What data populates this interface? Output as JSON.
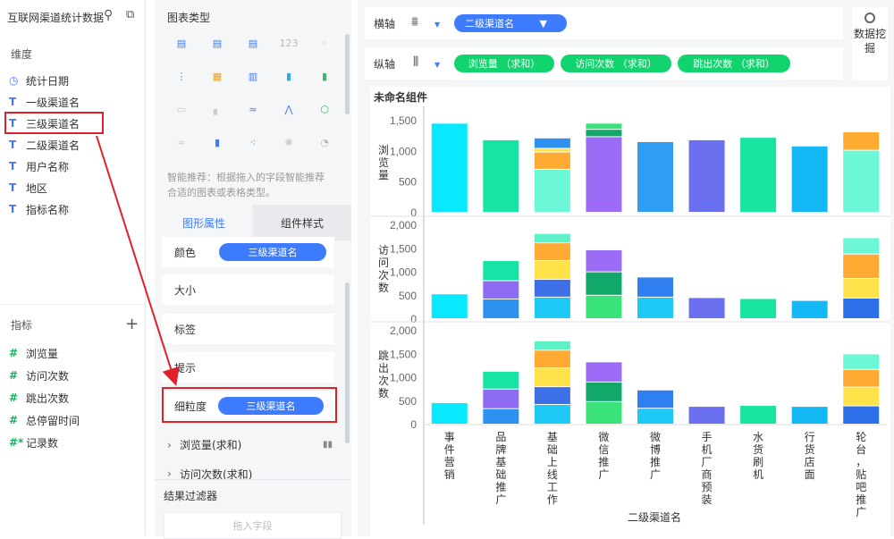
{
  "left": {
    "dataset_title": "互联网渠道统计数据",
    "search_icon": "search-icon",
    "switch_icon": "switch-icon",
    "dimension_title": "维度",
    "dimensions": [
      {
        "icon": "clock",
        "label": "统计日期"
      },
      {
        "icon": "T",
        "label": "一级渠道名"
      },
      {
        "icon": "T",
        "label": "三级渠道名"
      },
      {
        "icon": "T",
        "label": "二级渠道名"
      },
      {
        "icon": "T",
        "label": "用户名称"
      },
      {
        "icon": "T",
        "label": "地区"
      },
      {
        "icon": "T",
        "label": "指标名称"
      }
    ],
    "metric_title": "指标",
    "add_symbol": "+",
    "metrics": [
      {
        "icon": "#",
        "label": "浏览量"
      },
      {
        "icon": "#",
        "label": "访问次数"
      },
      {
        "icon": "#",
        "label": "跳出次数"
      },
      {
        "icon": "#",
        "label": "总停留时间"
      },
      {
        "icon": "#*",
        "label": "记录数"
      }
    ]
  },
  "middle": {
    "chart_type_title": "图表类型",
    "smart_tip": "智能推荐：根据拖入的字段智能推荐合适的图表或表格类型。",
    "tabs": {
      "graph": "图形属性",
      "style": "组件样式"
    },
    "props": {
      "color_label": "颜色",
      "color_field": "三级渠道名",
      "size_label": "大小",
      "tag_label": "标签",
      "tip_label": "提示",
      "granularity_label": "细粒度",
      "granularity_field": "三级渠道名"
    },
    "agg_rows": [
      "浏览量(求和)",
      "访问次数(求和)"
    ],
    "filter_title": "结果过滤器",
    "drop_placeholder": "拖入字段"
  },
  "axes": {
    "x_label": "横轴",
    "x_field": "二级渠道名",
    "y_label": "纵轴",
    "y_fields": [
      "浏览量 （求和）",
      "访问次数 （求和）",
      "跳出次数 （求和）"
    ],
    "data_mining": "数据挖掘"
  },
  "chart_data": {
    "type": "bar",
    "stacked": true,
    "title": "未命名组件",
    "xlabel": "二级渠道名",
    "categories": [
      "事件营销",
      "品牌基础推广",
      "基础上线工作",
      "微信推广",
      "微博推广",
      "手机厂商预装",
      "水货刷机",
      "行货店面",
      "轮台，贴吧推广"
    ],
    "panels": [
      {
        "ylabel": "浏览量",
        "ylim": [
          0,
          1600
        ],
        "yticks": [
          "1,500",
          "1,000",
          "500",
          "0"
        ],
        "stacks": [
          [
            {
              "v": 1450,
              "c": "#08e8ff"
            }
          ],
          [
            {
              "v": 1180,
              "c": "#16e3a4"
            }
          ],
          [
            {
              "v": 700,
              "c": "#6cf7d6"
            },
            {
              "v": 280,
              "c": "#ffaa33"
            },
            {
              "v": 60,
              "c": "#ffe14a"
            },
            {
              "v": 170,
              "c": "#2d92ef"
            }
          ],
          [
            {
              "v": 1230,
              "c": "#9c6cf7"
            },
            {
              "v": 120,
              "c": "#11a86a"
            },
            {
              "v": 100,
              "c": "#3ae27a"
            }
          ],
          [
            {
              "v": 1150,
              "c": "#2f9ef2"
            }
          ],
          [
            {
              "v": 1180,
              "c": "#6a6ff0"
            }
          ],
          [
            {
              "v": 1220,
              "c": "#19e5a2"
            }
          ],
          [
            {
              "v": 1080,
              "c": "#13b8f4"
            }
          ],
          [
            {
              "v": 1010,
              "c": "#6cf7d6"
            },
            {
              "v": 300,
              "c": "#ffaa33"
            }
          ]
        ]
      },
      {
        "ylabel": "访问次数",
        "ylim": [
          0,
          2100
        ],
        "yticks": [
          "2,000",
          "1,500",
          "1,000",
          "500",
          "0"
        ],
        "stacks": [
          [
            {
              "v": 530,
              "c": "#08e8ff"
            }
          ],
          [
            {
              "v": 420,
              "c": "#2d92ef"
            },
            {
              "v": 390,
              "c": "#8d6cf2"
            },
            {
              "v": 430,
              "c": "#16e3a4"
            }
          ],
          [
            {
              "v": 460,
              "c": "#1ec9f5"
            },
            {
              "v": 380,
              "c": "#3d6fe6"
            },
            {
              "v": 400,
              "c": "#ffe14a"
            },
            {
              "v": 380,
              "c": "#ffaa33"
            },
            {
              "v": 200,
              "c": "#5ef0c8"
            }
          ],
          [
            {
              "v": 500,
              "c": "#3ae27a"
            },
            {
              "v": 500,
              "c": "#11a86a"
            },
            {
              "v": 470,
              "c": "#9c6cf7"
            }
          ],
          [
            {
              "v": 460,
              "c": "#1ec9f5"
            },
            {
              "v": 430,
              "c": "#2f7ff0"
            }
          ],
          [
            {
              "v": 450,
              "c": "#6a6ff0"
            }
          ],
          [
            {
              "v": 430,
              "c": "#19e5a2"
            }
          ],
          [
            {
              "v": 390,
              "c": "#13b8f4"
            }
          ],
          [
            {
              "v": 440,
              "c": "#2d6fe8"
            },
            {
              "v": 420,
              "c": "#ffe14a"
            },
            {
              "v": 520,
              "c": "#ffaa33"
            },
            {
              "v": 350,
              "c": "#6cf7d6"
            }
          ]
        ]
      },
      {
        "ylabel": "跳出次数",
        "ylim": [
          0,
          2100
        ],
        "yticks": [
          "2,000",
          "1,500",
          "1,000",
          "500",
          "0"
        ],
        "stacks": [
          [
            {
              "v": 460,
              "c": "#08e8ff"
            }
          ],
          [
            {
              "v": 330,
              "c": "#2d92ef"
            },
            {
              "v": 420,
              "c": "#8d6cf2"
            },
            {
              "v": 380,
              "c": "#16e3a4"
            }
          ],
          [
            {
              "v": 420,
              "c": "#1ec9f5"
            },
            {
              "v": 380,
              "c": "#3d6fe6"
            },
            {
              "v": 400,
              "c": "#ffe14a"
            },
            {
              "v": 380,
              "c": "#ffaa33"
            },
            {
              "v": 200,
              "c": "#5ef0c8"
            }
          ],
          [
            {
              "v": 480,
              "c": "#3ae27a"
            },
            {
              "v": 420,
              "c": "#11a86a"
            },
            {
              "v": 430,
              "c": "#9c6cf7"
            }
          ],
          [
            {
              "v": 340,
              "c": "#1ec9f5"
            },
            {
              "v": 390,
              "c": "#2f7ff0"
            }
          ],
          [
            {
              "v": 380,
              "c": "#6a6ff0"
            }
          ],
          [
            {
              "v": 400,
              "c": "#19e5a2"
            }
          ],
          [
            {
              "v": 380,
              "c": "#13b8f4"
            }
          ],
          [
            {
              "v": 390,
              "c": "#2d6fe8"
            },
            {
              "v": 400,
              "c": "#ffe14a"
            },
            {
              "v": 380,
              "c": "#ffaa33"
            },
            {
              "v": 330,
              "c": "#6cf7d6"
            }
          ]
        ]
      }
    ]
  },
  "colors": {
    "accent": "#3d7bff",
    "green": "#11d46f",
    "highlight": "#e0212b"
  }
}
